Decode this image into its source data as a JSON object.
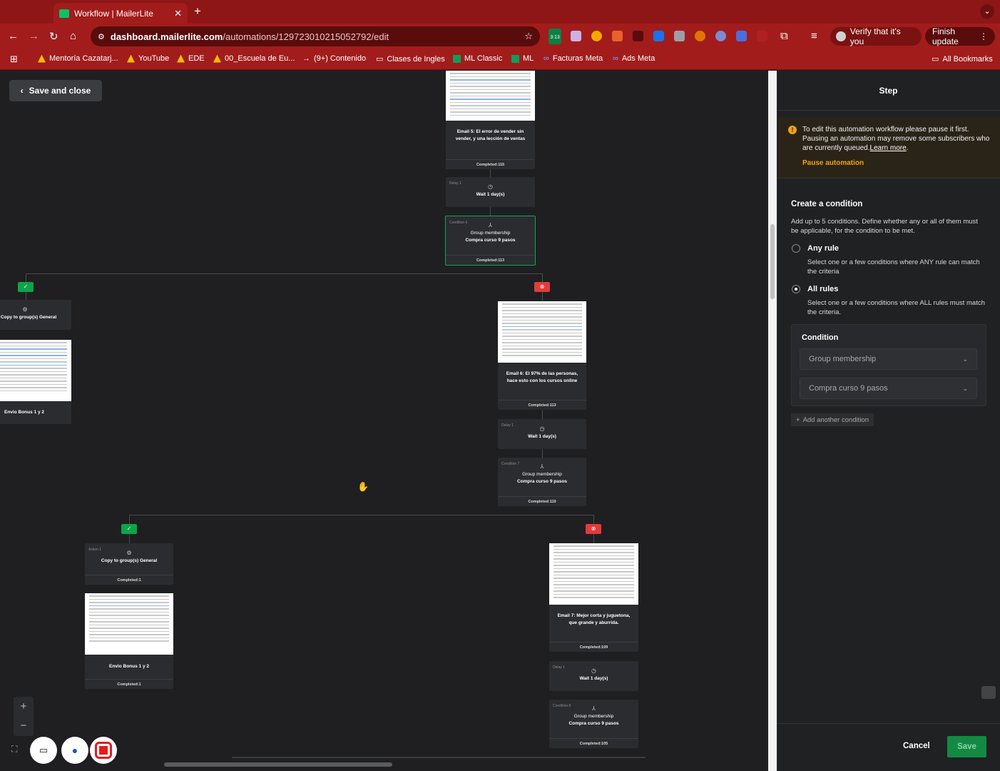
{
  "browser": {
    "tab_title": "Workflow | MailerLite",
    "url_host": "dashboard.mailerlite.com",
    "url_path": "/automations/129723010215052792/edit",
    "verify_label": "Verify that it's you",
    "finish_update_label": "Finish update",
    "calendar_badge": "3:13",
    "bookmarks": [
      "Mentoría Cazatarj...",
      "YouTube",
      "EDE",
      "00_Escuela de Eu...",
      "(9+) Contenido",
      "Clases de Ingles",
      "ML Classic",
      "ML",
      "Facturas Meta",
      "Ads Meta"
    ],
    "all_bookmarks": "All Bookmarks"
  },
  "canvas": {
    "save_close_label": "Save and close",
    "nodes": {
      "email5_title": "Email 5: El error de vender sin vender, y una lección de ventas",
      "email5_completed": "Completed:115",
      "delay1_tag": "Delay 1",
      "delay1_title": "Wait 1 day(s)",
      "cond6_tag": "Condition 6",
      "cond6_title1": "Group membership",
      "cond6_title2": "Compra curso 9 pasos",
      "cond6_completed": "Completed:113",
      "left_copy_title": "Copy to group(s) General",
      "left_bonus_title": "Envio Bonus 1 y 2",
      "email6_title": "Email 6: El 97% de las personas, hace esto con los cursos online",
      "email6_completed": "Completed:113",
      "delay2_tag": "Delay 1",
      "delay2_title": "Wait 1 day(s)",
      "cond7_tag": "Condition 7",
      "cond7_title1": "Group membership",
      "cond7_title2": "Compra curso 9 pasos",
      "cond7_completed": "Completed:110",
      "action1_tag": "Action 1",
      "action1_title": "Copy to group(s) General",
      "action1_completed": "Completed:1",
      "bonus2_title": "Envio Bonus 1 y 2",
      "bonus2_completed": "Completed:1",
      "email7_title": "Email 7: Mejor corta y juguetona, que grande y aburrida.",
      "email7_completed": "Completed:109",
      "delay3_tag": "Delay 1",
      "delay3_title": "Wait 1 day(s)",
      "cond8_tag": "Condition 8",
      "cond8_title1": "Group membership",
      "cond8_title2": "Compra curso 9 pasos",
      "cond8_completed": "Completed:105"
    }
  },
  "panel": {
    "title": "Step",
    "warning_text": "To edit this automation workflow please pause it first. Pausing an automation may remove some subscribers who are currently queued.",
    "learn_more": "Learn more",
    "pause_label": "Pause automation",
    "create_heading": "Create a condition",
    "create_desc": "Add up to 5 conditions. Define whether any or all of them must be applicable, for the condition to be met.",
    "any_rule_label": "Any rule",
    "any_rule_desc": "Select one or a few conditions where ANY rule can match the criteria",
    "all_rules_label": "All rules",
    "all_rules_desc": "Select one or a few conditions where ALL rules must match the criteria.",
    "selected_rule": "All rules",
    "condition_heading": "Condition",
    "condition_type": "Group membership",
    "condition_group": "Compra curso 9 pasos",
    "add_condition_label": "Add another condition",
    "cancel_label": "Cancel",
    "save_label": "Save"
  },
  "colors": {
    "browser_red": "#a21c1c",
    "yes_green": "#0fa34a",
    "no_red": "#e23b3b",
    "warn_orange": "#f0a315",
    "save_green": "#138a43"
  }
}
